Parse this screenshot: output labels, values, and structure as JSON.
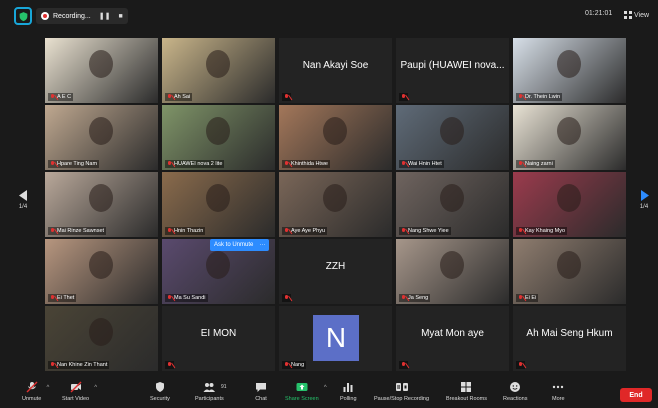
{
  "topbar": {
    "recording_label": "Recording...",
    "pause_glyph": "❚❚",
    "stop_glyph": "■",
    "timer": "01:21:01",
    "view_label": "View"
  },
  "grid": {
    "page_left": "1/4",
    "page_right": "1/4",
    "tiles": [
      {
        "name": "A E C",
        "type": "photo",
        "color": "#e9e1d0"
      },
      {
        "name": "Ah Sai",
        "type": "photo",
        "color": "#c9b58a"
      },
      {
        "name": "Nan Akayi Soe",
        "type": "text"
      },
      {
        "name": "Paupi (HUAWEI nova...",
        "type": "text"
      },
      {
        "name": "Dr. Thein Lwin",
        "type": "photo",
        "color": "#d7dfe8",
        "active": true
      },
      {
        "name": "Hpare Ting Nam",
        "type": "photo",
        "color": "#bfa890"
      },
      {
        "name": "HUAWEI nova 2 lite",
        "type": "photo",
        "color": "#7f9468"
      },
      {
        "name": "Khinthida Htwe",
        "type": "photo",
        "color": "#a3775a"
      },
      {
        "name": "Wai Hnin Htet",
        "type": "photo",
        "color": "#5f6b78"
      },
      {
        "name": "Naing zarni",
        "type": "photo",
        "color": "#e8e2d4"
      },
      {
        "name": "Mai Rinze Sawnset",
        "type": "photo",
        "color": "#b9a89a"
      },
      {
        "name": "Hnin Thazin",
        "type": "photo",
        "color": "#8a6b4c"
      },
      {
        "name": "Aye Aye Phyu",
        "type": "photo",
        "color": "#7a6658"
      },
      {
        "name": "Nang Shwe Yiee",
        "type": "photo",
        "color": "#6f645f"
      },
      {
        "name": "Kay Khaing Myo",
        "type": "photo",
        "color": "#9b3b4d"
      },
      {
        "name": "Ei Thet",
        "type": "photo",
        "color": "#b7967f"
      },
      {
        "name": "Ma Su Sandi",
        "type": "photo",
        "color": "#5a4a6e"
      },
      {
        "name": "ZZH",
        "type": "text"
      },
      {
        "name": "Ja Seng",
        "type": "photo",
        "color": "#a6968a"
      },
      {
        "name": "Ei Ei",
        "type": "photo",
        "color": "#8f7d6f"
      },
      {
        "name": "Nan Khine Zin Thant",
        "type": "photo",
        "color": "#4a4436"
      },
      {
        "name": "EI MON",
        "type": "text"
      },
      {
        "name": "Nang",
        "type": "avatar",
        "initial": "N"
      },
      {
        "name": "Myat Mon aye",
        "type": "text"
      },
      {
        "name": "Ah Mai Seng Hkum",
        "type": "text"
      }
    ],
    "unmute_popup": {
      "label": "Ask to Unmute",
      "more": "···"
    }
  },
  "toolbar": {
    "unmute": "Unmute",
    "start_video": "Start Video",
    "security": "Security",
    "participants": "Participants",
    "participants_count": "91",
    "chat": "Chat",
    "share_screen": "Share Screen",
    "polling": "Polling",
    "pause_stop_recording": "Pause/Stop Recording",
    "breakout_rooms": "Breakout Rooms",
    "reactions": "Reactions",
    "more": "More",
    "end": "End"
  },
  "colors": {
    "accent_blue": "#2d8cff",
    "share_green": "#26c26b",
    "end_red": "#e02828",
    "active_speaker": "#d4e91c"
  }
}
